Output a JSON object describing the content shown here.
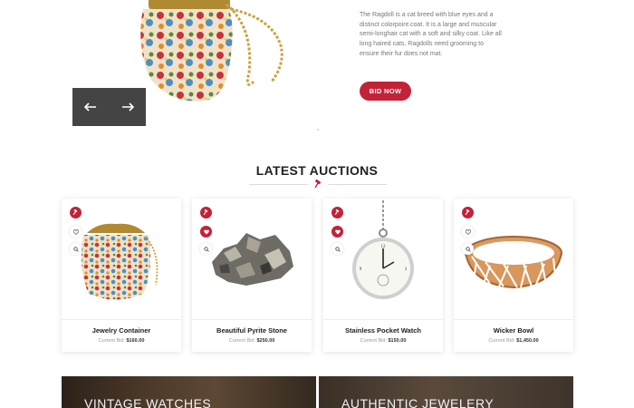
{
  "hero": {
    "description": "The Ragdoll is a cat breed with blue eyes and a distinct colorpoint coat. It is a large and muscular semi-longhair cat with a soft and silky coat. Like all long haired cats, Ragdolls need grooming to ensure their fur does not mat.",
    "bid_button": "BID NOW",
    "prev_icon": "arrow-left-icon",
    "next_icon": "arrow-right-icon"
  },
  "section": {
    "title": "LATEST AUCTIONS",
    "divider_icon": "gavel-icon"
  },
  "products": [
    {
      "name": "Jewelry Container",
      "bid_label": "Current Bid:",
      "bid_value": "$160.00",
      "image": "floral-purse",
      "wishlisted": false
    },
    {
      "name": "Beautiful Pyrite Stone",
      "bid_label": "Current Bid:",
      "bid_value": "$250.00",
      "image": "pyrite-stone",
      "wishlisted": true
    },
    {
      "name": "Stainless Pocket Watch",
      "bid_label": "Current Bid:",
      "bid_value": "$150.00",
      "image": "pocket-watch",
      "wishlisted": true
    },
    {
      "name": "Wicker Bowl",
      "bid_label": "Current Bid:",
      "bid_value": "$1,450.00",
      "image": "wicker-bowl",
      "wishlisted": false
    }
  ],
  "banners": [
    {
      "label": "VINTAGE WATCHES"
    },
    {
      "label": "AUTHENTIC JEWELERY"
    }
  ],
  "colors": {
    "accent": "#c22338",
    "dark": "#444444",
    "text": "#222222",
    "muted": "#777777"
  }
}
